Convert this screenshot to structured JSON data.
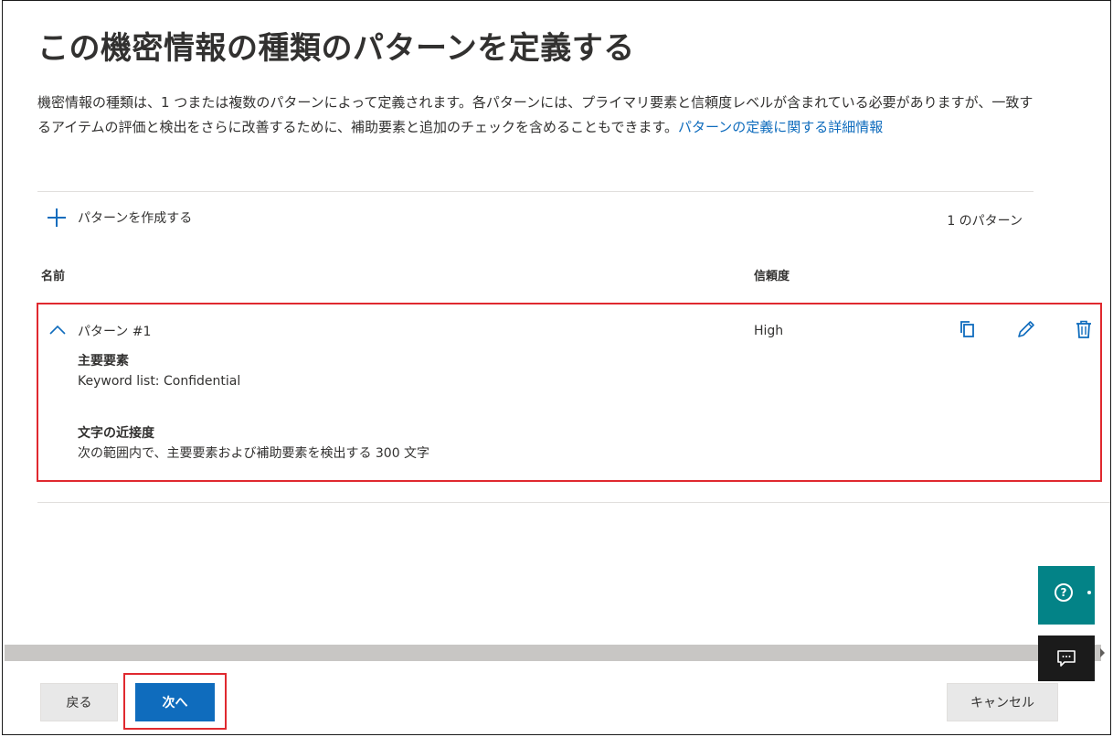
{
  "page": {
    "title": "この機密情報の種類のパターンを定義する",
    "description": "機密情報の種類は、1 つまたは複数のパターンによって定義されます。各パターンには、プライマリ要素と信頼度レベルが含まれている必要がありますが、一致するアイテムの評価と検出をさらに改善するために、補助要素と追加のチェックを含めることもできます。",
    "learn_more_link": "パターンの定義に関する詳細情報"
  },
  "toolbar": {
    "create_label": "パターンを作成する",
    "pattern_count": "1 のパターン"
  },
  "table": {
    "columns": [
      "名前",
      "信頼度"
    ],
    "rows": [
      {
        "name": "パターン #1",
        "confidence": "High",
        "primary_element_heading": "主要要素",
        "primary_element_label": "Keyword list:",
        "primary_element_value": "Confidential",
        "proximity_heading": "文字の近接度",
        "proximity_value": "次の範囲内で、主要要素および補助要素を検出する 300 文字"
      }
    ]
  },
  "footer": {
    "back_label": "戻る",
    "next_label": "次へ",
    "cancel_label": "キャンセル"
  },
  "side_buttons": {
    "help_icon": "question-circle-icon",
    "feedback_icon": "chat-feedback-icon"
  },
  "colors": {
    "accent": "#0f6cbd",
    "highlight": "#e0292f",
    "help_bg": "#038387",
    "feedback_bg": "#1b1b1b"
  }
}
